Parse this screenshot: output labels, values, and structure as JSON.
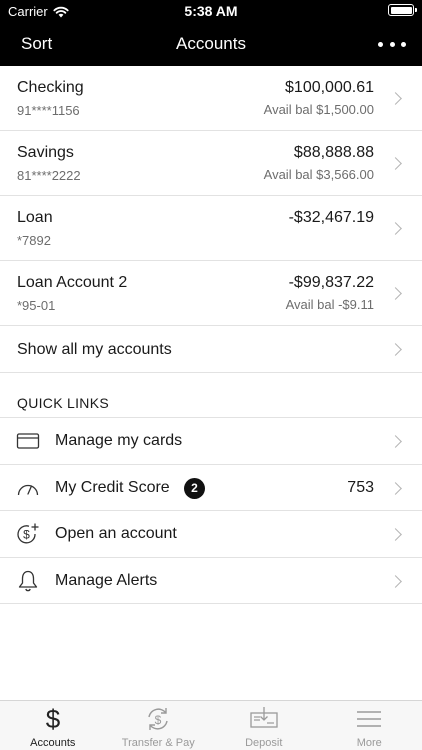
{
  "status_bar": {
    "carrier": "Carrier",
    "time": "5:38 AM"
  },
  "nav": {
    "left_label": "Sort",
    "title": "Accounts",
    "menu_icon": "more-dots-icon"
  },
  "accounts": [
    {
      "name": "Checking",
      "number": "91****1156",
      "balance": "$100,000.61",
      "available": "Avail bal $1,500.00"
    },
    {
      "name": "Savings",
      "number": "81****2222",
      "balance": "$88,888.88",
      "available": "Avail bal $3,566.00"
    },
    {
      "name": "Loan",
      "number": "*7892",
      "balance": "-$32,467.19",
      "available": ""
    },
    {
      "name": "Loan Account 2",
      "number": "*95-01",
      "balance": "-$99,837.22",
      "available": "Avail bal -$9.11"
    }
  ],
  "show_all_label": "Show all my accounts",
  "quick_links": {
    "header": "QUICK LINKS",
    "items": [
      {
        "label": "Manage my cards",
        "icon": "credit-card-icon"
      },
      {
        "label": "My Credit Score",
        "icon": "gauge-icon",
        "badge": "2",
        "value": "753"
      },
      {
        "label": "Open an account",
        "icon": "dollar-plus-icon"
      },
      {
        "label": "Manage Alerts",
        "icon": "bell-icon"
      }
    ]
  },
  "tab_bar": {
    "tabs": [
      {
        "label": "Accounts",
        "icon": "dollar-icon",
        "active": true
      },
      {
        "label": "Transfer & Pay",
        "icon": "transfer-cycle-icon",
        "active": false
      },
      {
        "label": "Deposit",
        "icon": "check-deposit-icon",
        "active": false
      },
      {
        "label": "More",
        "icon": "menu-lines-icon",
        "active": false
      }
    ]
  },
  "colors": {
    "nav_background": "#000000",
    "badge": "#111111",
    "secondary_text": "#6d6d6d",
    "inactive_tab": "#9a9a9a"
  }
}
